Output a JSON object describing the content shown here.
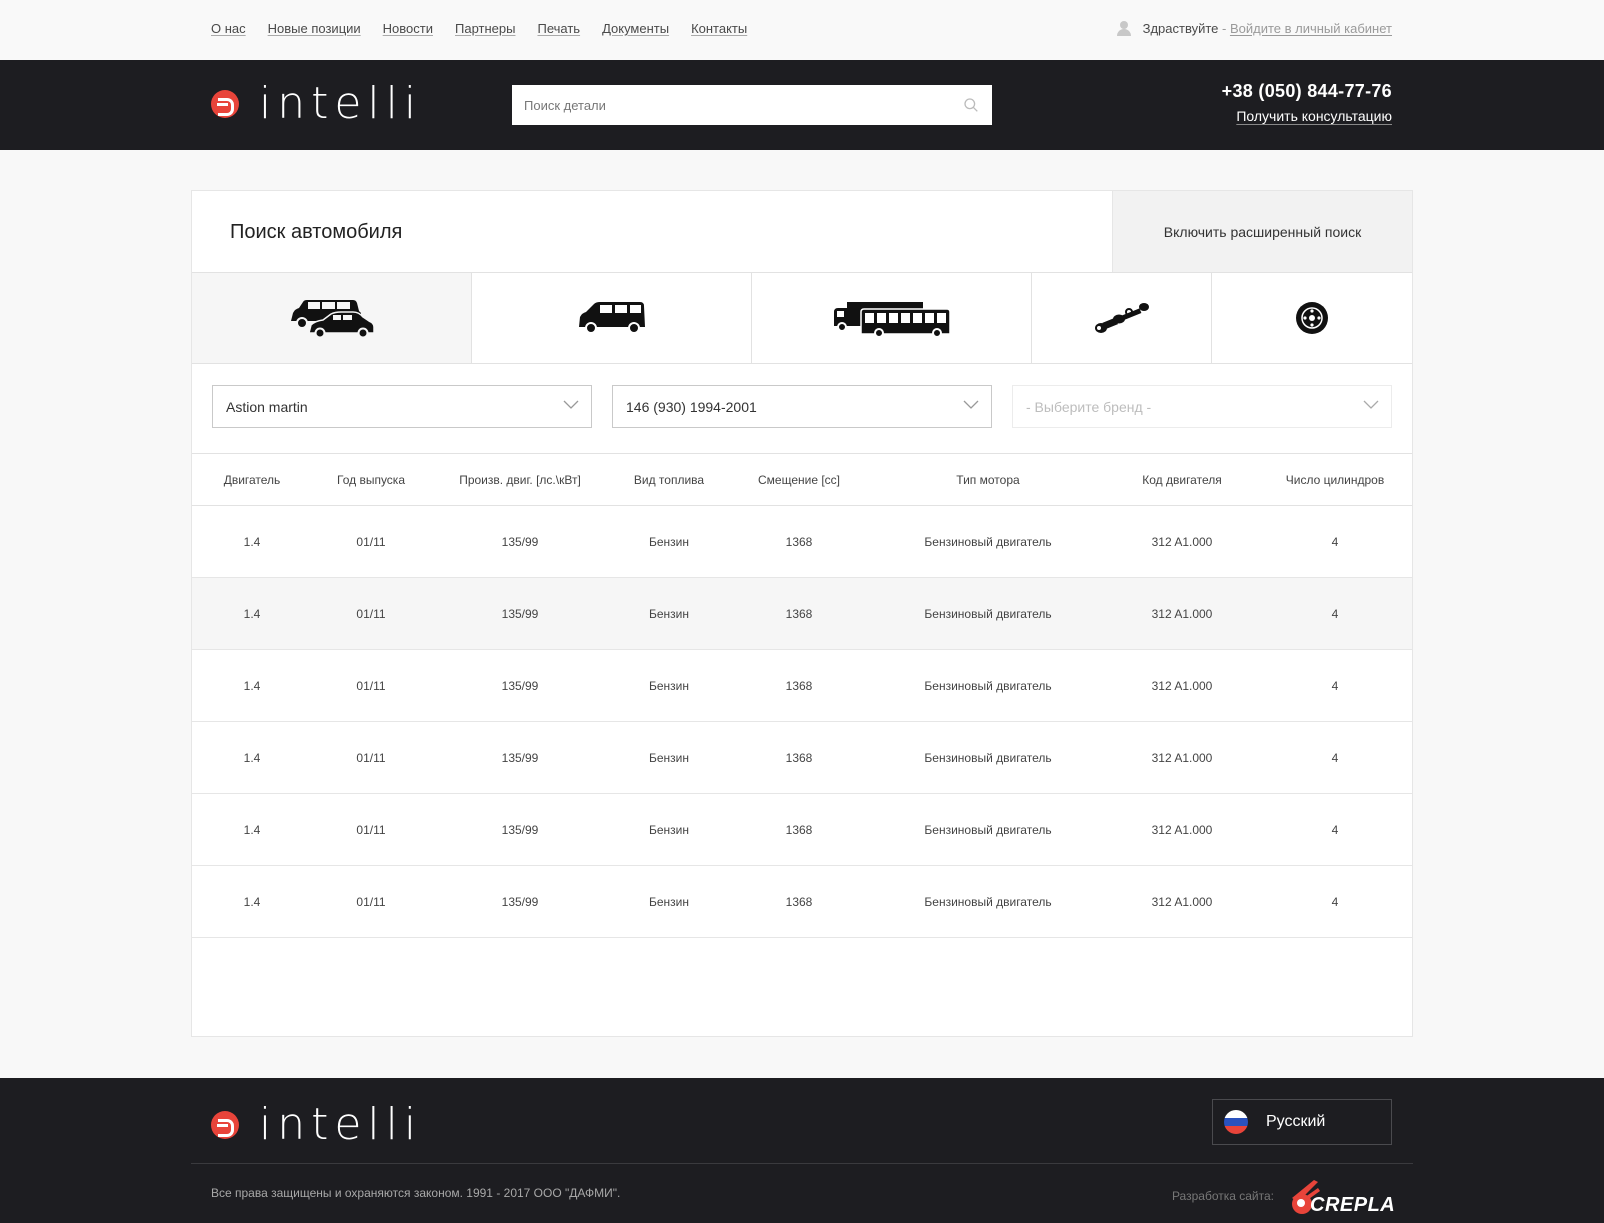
{
  "topnav": {
    "links": [
      "О нас",
      "Новые позиции",
      "Новости",
      "Партнеры",
      "Печать",
      "Документы",
      "Контакты"
    ],
    "greeting": "Здраствуйте",
    "separator": " - ",
    "login_link": "Войдите в личный кабинет"
  },
  "header": {
    "logo_text": "intelli",
    "search_placeholder": "Поиск детали",
    "phone": "+38 (050) 844-77-76",
    "consult_link": "Получить консультацию"
  },
  "search_card": {
    "title": "Поиск автомобиля",
    "advanced_button": "Включить расширенный поиск",
    "vehicle_types": [
      "passenger-cars-icon",
      "minivan-icon",
      "truck-bus-icon",
      "axle-icon",
      "brake-disc-icon"
    ],
    "active_type_index": 0,
    "filters": {
      "brand": "Astion martin",
      "model": "146 (930) 1994-2001",
      "third_placeholder": "- Выберите бренд -"
    }
  },
  "table": {
    "headers": [
      "Двигатель",
      "Год выпуска",
      "Произв. двиг. [лс.\\кВт]",
      "Вид топлива",
      "Смещение [cc]",
      "Тип мотора",
      "Код двигателя",
      "Число цилиндров"
    ],
    "rows": [
      [
        "1.4",
        "01/11",
        "135/99",
        "Бензин",
        "1368",
        "Бензиновый двигатель",
        "312 A1.000",
        "4"
      ],
      [
        "1.4",
        "01/11",
        "135/99",
        "Бензин",
        "1368",
        "Бензиновый двигатель",
        "312 A1.000",
        "4"
      ],
      [
        "1.4",
        "01/11",
        "135/99",
        "Бензин",
        "1368",
        "Бензиновый двигатель",
        "312 A1.000",
        "4"
      ],
      [
        "1.4",
        "01/11",
        "135/99",
        "Бензин",
        "1368",
        "Бензиновый двигатель",
        "312 A1.000",
        "4"
      ],
      [
        "1.4",
        "01/11",
        "135/99",
        "Бензин",
        "1368",
        "Бензиновый двигатель",
        "312 A1.000",
        "4"
      ],
      [
        "1.4",
        "01/11",
        "135/99",
        "Бензин",
        "1368",
        "Бензиновый двигатель",
        "312 A1.000",
        "4"
      ]
    ],
    "highlighted_row_index": 1
  },
  "footer": {
    "logo_text": "intelli",
    "language": "Русский",
    "copyright": "Все права защищены и охраняются законом. 1991 - 2017 ООО \"ДАФМИ\".",
    "dev_label": "Разработка сайта:",
    "dev_brand": "CREPLA"
  },
  "colors": {
    "dark": "#1d1d21",
    "accent": "#e8443a"
  }
}
